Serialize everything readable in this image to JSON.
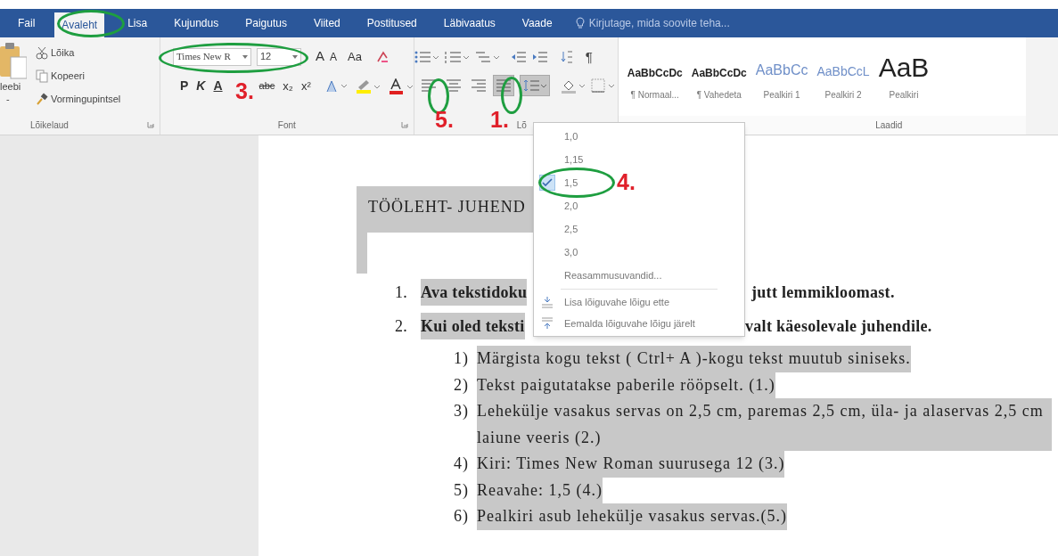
{
  "tabs": [
    {
      "label": "Fail",
      "selected": false
    },
    {
      "label": "Avaleht",
      "selected": true
    },
    {
      "label": "Lisa",
      "selected": false
    },
    {
      "label": "Kujundus",
      "selected": false
    },
    {
      "label": "Paigutus",
      "selected": false
    },
    {
      "label": "Viited",
      "selected": false
    },
    {
      "label": "Postitused",
      "selected": false
    },
    {
      "label": "Läbivaatus",
      "selected": false
    },
    {
      "label": "Vaade",
      "selected": false
    }
  ],
  "search": {
    "placeholder": "Kirjutage, mida soovite teha..."
  },
  "clipboard": {
    "paste_label": "leebi",
    "paste_caret": "-",
    "items": [
      {
        "label": "Lõika",
        "kind": "cut"
      },
      {
        "label": "Kopeeri",
        "kind": "copy"
      },
      {
        "label": "Vormingupintsel",
        "kind": "brush"
      }
    ],
    "group_label": "Lõikelaud"
  },
  "font": {
    "font_name": "Times New R",
    "font_size": "12",
    "grow": "A",
    "shrink": "A",
    "case": "Aa",
    "bold": "P",
    "italic": "K",
    "underline": "A",
    "strike": "abc",
    "subscript": "x₂",
    "superscript": "x²",
    "group_label": "Font"
  },
  "paragraph": {
    "pilcrow": "¶",
    "alignments": [
      {
        "kind": "left",
        "selected": false
      },
      {
        "kind": "center",
        "selected": false
      },
      {
        "kind": "right",
        "selected": false
      },
      {
        "kind": "justify",
        "selected": true
      }
    ],
    "line_spacing_expanded": true,
    "group_label": "Lõ"
  },
  "styles": {
    "items": [
      {
        "preview": "AaBbCcDc",
        "label": "¶ Normaal...",
        "kind": "normal"
      },
      {
        "preview": "AaBbCcDc",
        "label": "¶ Vahedeta",
        "kind": "normal"
      },
      {
        "preview": "AaBbCc",
        "label": "Pealkiri 1",
        "kind": "heading1"
      },
      {
        "preview": "AaBbCcL",
        "label": "Pealkiri 2",
        "kind": "heading2"
      },
      {
        "preview": "AaB",
        "label": "Pealkiri",
        "kind": "title"
      }
    ],
    "group_label": "Laadid"
  },
  "document": {
    "heading": "TÖÖLEHT- JUHEND",
    "steps": [
      {
        "number": "1.",
        "text_before": "Ava tekstidoku",
        "text_after": "jutt lemmikloomast."
      },
      {
        "number": "2.",
        "text_before": "Kui oled teksti",
        "text_after": "valt käesolevale juhendile."
      }
    ],
    "substeps": [
      {
        "number": "1)",
        "text": "Märgista kogu tekst ( Ctrl+ A )-kogu tekst muutub siniseks."
      },
      {
        "number": "2)",
        "text": "Tekst paigutatakse paberile rööpselt. (1.)"
      },
      {
        "number": "3)",
        "text": "Lehekülje vasakus servas on 2,5 cm, paremas 2,5 cm, üla- ja alaservas 2,5 cm laiune veeris (2.)"
      },
      {
        "number": "4)",
        "text": "Kiri: Times New Roman suurusega 12 (3.)"
      },
      {
        "number": "5)",
        "text": "Reavahe: 1,5 (4.)"
      },
      {
        "number": "6)",
        "text": "Pealkiri asub lehekülje vasakus servas.(5.)"
      }
    ]
  },
  "line_spacing_menu": {
    "options": [
      {
        "label": "1,0",
        "checked": false
      },
      {
        "label": "1,15",
        "checked": false
      },
      {
        "label": "1,5",
        "checked": true
      },
      {
        "label": "2,0",
        "checked": false
      },
      {
        "label": "2,5",
        "checked": false
      },
      {
        "label": "3,0",
        "checked": false
      }
    ],
    "more": "Reasammusuvandid...",
    "actions": [
      {
        "label": "Lisa lõiguvahe lõigu ette",
        "kind": "add_before"
      },
      {
        "label": "Eemalda lõiguvahe lõigu järelt",
        "kind": "remove_after"
      }
    ]
  },
  "annotations": [
    {
      "label": "3."
    },
    {
      "label": "5."
    },
    {
      "label": "1."
    },
    {
      "label": "4."
    }
  ]
}
